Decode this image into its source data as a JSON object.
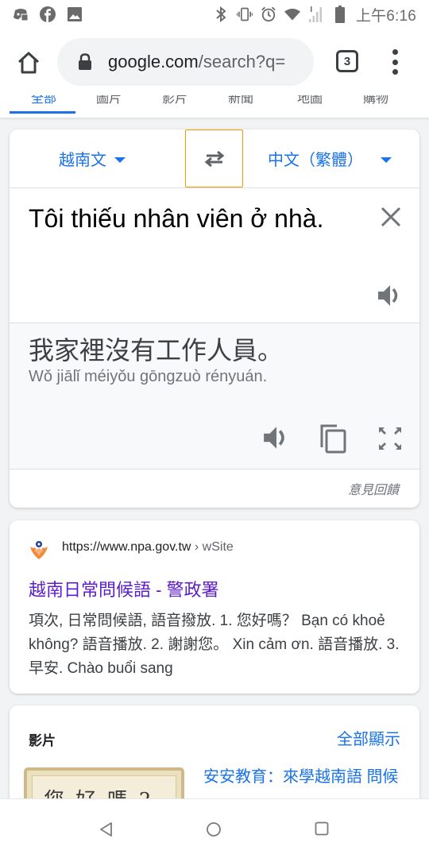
{
  "status_bar": {
    "time": "上午6:16",
    "left_icons": [
      "discord-icon",
      "facebook-icon",
      "gallery-icon"
    ],
    "right_icons": [
      "bluetooth-icon",
      "vibrate-icon",
      "alarm-icon",
      "wifi-icon",
      "signal-icon",
      "battery-icon"
    ]
  },
  "browser": {
    "url_host": "google.com",
    "url_path": "/search?q=",
    "tab_count": "3"
  },
  "search_tabs": [
    {
      "label": "全部",
      "active": true
    },
    {
      "label": "圖片",
      "active": false
    },
    {
      "label": "影片",
      "active": false
    },
    {
      "label": "新聞",
      "active": false
    },
    {
      "label": "地圖",
      "active": false
    },
    {
      "label": "購物",
      "active": false
    }
  ],
  "translate": {
    "source_lang": "越南文",
    "target_lang": "中文（繁體）",
    "source_text": "Tôi thiếu nhân viên ở nhà.",
    "translated_text": "我家裡沒有工作人員。",
    "romanization": "Wǒ jiālǐ méiyǒu gōngzuò rényuán.",
    "feedback_label": "意見回饋",
    "swap_highlight_color": "#f29900",
    "accent_color": "#1a73e8"
  },
  "result": {
    "url": "https://www.npa.gov.tw",
    "breadcrumb": "› wSite",
    "title": "越南日常問候語 - 警政署",
    "snippet": "項次, 日常問候語, 語音撥放. 1. 您好嗎？ Bạn có khoẻ không? 語音播放. 2. 謝謝您。 Xin cảm ơn. 語音播放. 3. 早安. Chào buổi sang",
    "title_color": "#5c1ecb"
  },
  "videos": {
    "heading": "影片",
    "show_all": "全部顯示",
    "items": [
      {
        "title": "安安教育：來學越南語 問候",
        "thumbnail_text": "您好嗎?"
      }
    ]
  },
  "nav_bar": {
    "buttons": [
      "back",
      "home",
      "recents"
    ]
  }
}
